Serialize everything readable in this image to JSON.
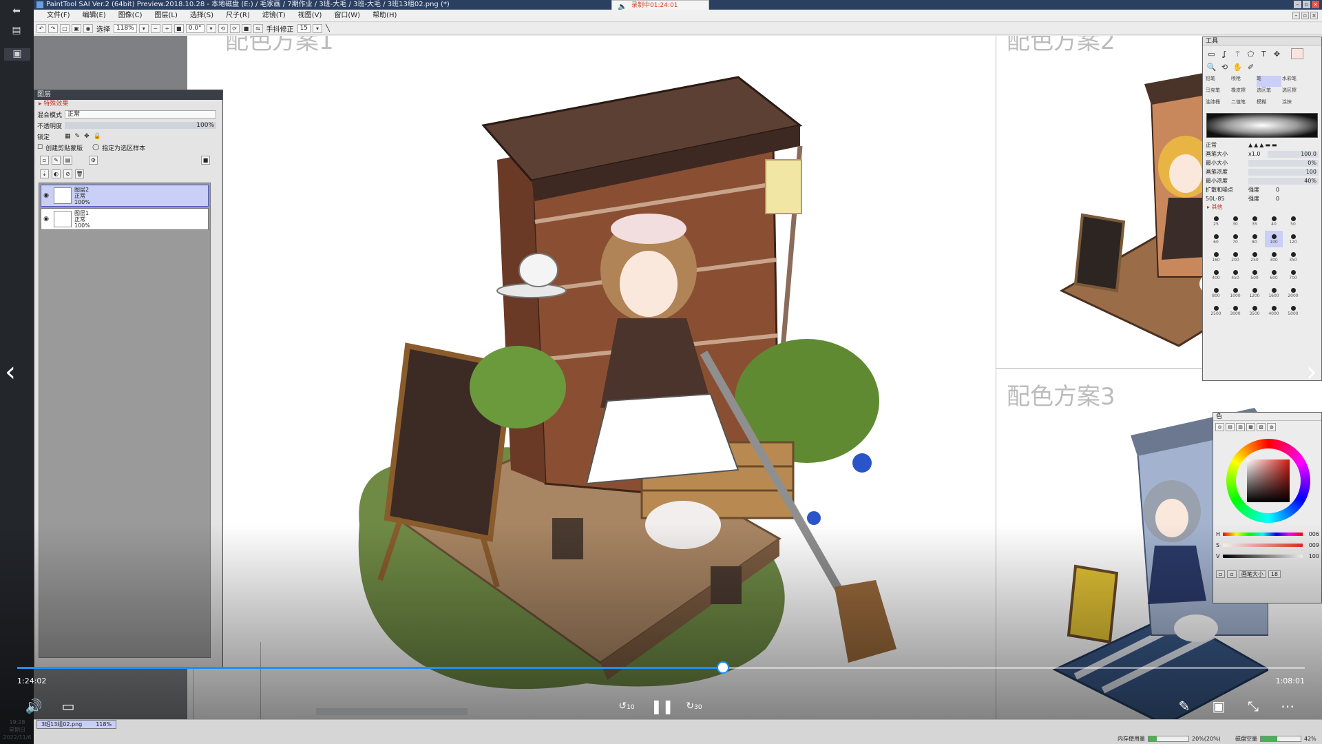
{
  "window": {
    "title": "PaintTool SAI Ver.2 (64bit) Preview.2018.10.28 - 本地磁盘 (E:) / 毛家画 / 7期作业 / 3班-大毛 / 3班-大毛 / 3班13组02.png (*)",
    "recording": "录制中01:24:01"
  },
  "menu": [
    "文件(F)",
    "编辑(E)",
    "图像(C)",
    "图层(L)",
    "选择(S)",
    "尺子(R)",
    "滤镜(T)",
    "视图(V)",
    "窗口(W)",
    "帮助(H)"
  ],
  "toolbar": {
    "select_label": "选择",
    "zoom": "118%",
    "angle": "0.0°",
    "stabilizer_label": "手抖修正",
    "stabilizer_value": "15"
  },
  "canvas": {
    "scheme1": "配色方案1",
    "scheme2": "配色方案2",
    "scheme3": "配色方案3"
  },
  "layer_panel": {
    "title": "图层",
    "effects": "特殊效果",
    "blend_label": "混合模式",
    "blend_value": "正常",
    "opacity_label": "不透明度",
    "opacity_value": "100%",
    "lock_label": "锁定",
    "clip_label": "创建剪贴蒙版",
    "ref_label": "指定为选区样本",
    "layers": [
      {
        "name": "图层2",
        "mode": "正常",
        "opacity": "100%"
      },
      {
        "name": "图层1",
        "mode": "正常",
        "opacity": "100%"
      }
    ]
  },
  "tool_panel": {
    "title": "工具",
    "tools": [
      "铅笔",
      "喷枪",
      "笔",
      "水彩笔",
      "马克笔",
      "橡皮擦",
      "选区笔",
      "选区擦",
      "油漆桶",
      "二值笔",
      "模糊",
      "涂抹"
    ],
    "blend_mode": "正常",
    "brush_size_label": "画笔大小",
    "brush_size_mult": "x1.0",
    "brush_size_value": "100.0",
    "min_size_label": "最小大小",
    "min_size_value": "0%",
    "density_label": "画笔浓度",
    "density_value": "100",
    "min_density_label": "最小浓度",
    "min_density_value": "40%",
    "shape_label": "扩散和噪点",
    "shape_value": "强度",
    "shape_num": "0",
    "texture_label": "50L-85",
    "texture_value": "强度",
    "texture_num": "0",
    "other_label": "其他",
    "sizes": [
      "25",
      "30",
      "35",
      "40",
      "50",
      "60",
      "70",
      "80",
      "100",
      "120",
      "160",
      "200",
      "250",
      "300",
      "350",
      "400",
      "450",
      "500",
      "600",
      "700",
      "800",
      "1000",
      "1200",
      "1600",
      "2000",
      "2500",
      "3000",
      "3500",
      "4000",
      "5000"
    ],
    "selected_size": "100"
  },
  "color_panel": {
    "title": "色",
    "h_value": "006",
    "s_value": "009",
    "v_value": "100",
    "brush_size_label": "画笔大小",
    "brush_size_value": "18"
  },
  "player": {
    "elapsed": "1:24:02",
    "remaining": "1:08:01",
    "progress": 0.548,
    "skip_back": "10",
    "skip_forward": "30"
  },
  "status": {
    "filename": "3班13组02.png",
    "zoom": "118%",
    "mem_label": "内存使用量",
    "mem_value": "20%(20%)",
    "mem_fraction": 0.2,
    "disk_label": "磁盘空量",
    "disk_value": "42%",
    "disk_fraction": 0.42
  },
  "os": {
    "time": "19:28",
    "weekday": "星期日",
    "date": "2022/11/6"
  },
  "colors": {
    "accent": "#1e90ff",
    "selected_layer": "#c9cff6",
    "title_bar": "#2b3f60"
  }
}
